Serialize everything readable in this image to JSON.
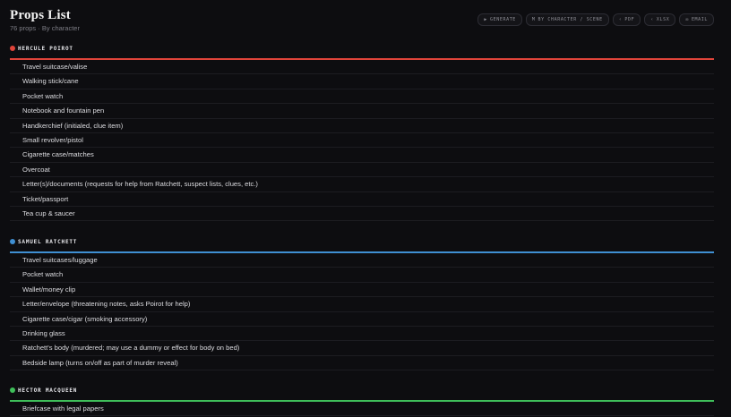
{
  "header": {
    "title": "Props List",
    "subtitle": "76 props · By character"
  },
  "toolbar": {
    "buttons": [
      {
        "icon": "▶",
        "icon_name": "play-icon",
        "label": "GENERATE"
      },
      {
        "icon": "µ",
        "icon_name": "view-toggle-icon",
        "label": "BY CHARACTER / SCENE"
      },
      {
        "icon": "‹",
        "icon_name": "pdf-icon",
        "label": "PDF"
      },
      {
        "icon": "‹",
        "icon_name": "xlsx-icon",
        "label": "XLSX"
      },
      {
        "icon": "✉",
        "icon_name": "email-icon",
        "label": "EMAIL"
      }
    ]
  },
  "sections": [
    {
      "name": "HERCULE POIROT",
      "color": "#e0443a",
      "items": [
        "Travel suitcase/valise",
        "Walking stick/cane",
        "Pocket watch",
        "Notebook and fountain pen",
        "Handkerchief (initialed, clue item)",
        "Small revolver/pistol",
        "Cigarette case/matches",
        "Overcoat",
        "Letter(s)/documents (requests for help from Ratchett, suspect lists, clues, etc.)",
        "Ticket/passport",
        "Tea cup & saucer"
      ]
    },
    {
      "name": "SAMUEL RATCHETT",
      "color": "#3f8fd2",
      "items": [
        "Travel suitcases/luggage",
        "Pocket watch",
        "Wallet/money clip",
        "Letter/envelope (threatening notes, asks Poirot for help)",
        "Cigarette case/cigar (smoking accessory)",
        "Drinking glass",
        "Ratchett's body (murdered; may use a dummy or effect for body on bed)",
        "Bedside lamp (turns on/off as part of murder reveal)"
      ]
    },
    {
      "name": "HECTOR MACQUEEN",
      "color": "#3fbf5a",
      "items": [
        "Briefcase with legal papers"
      ]
    }
  ]
}
